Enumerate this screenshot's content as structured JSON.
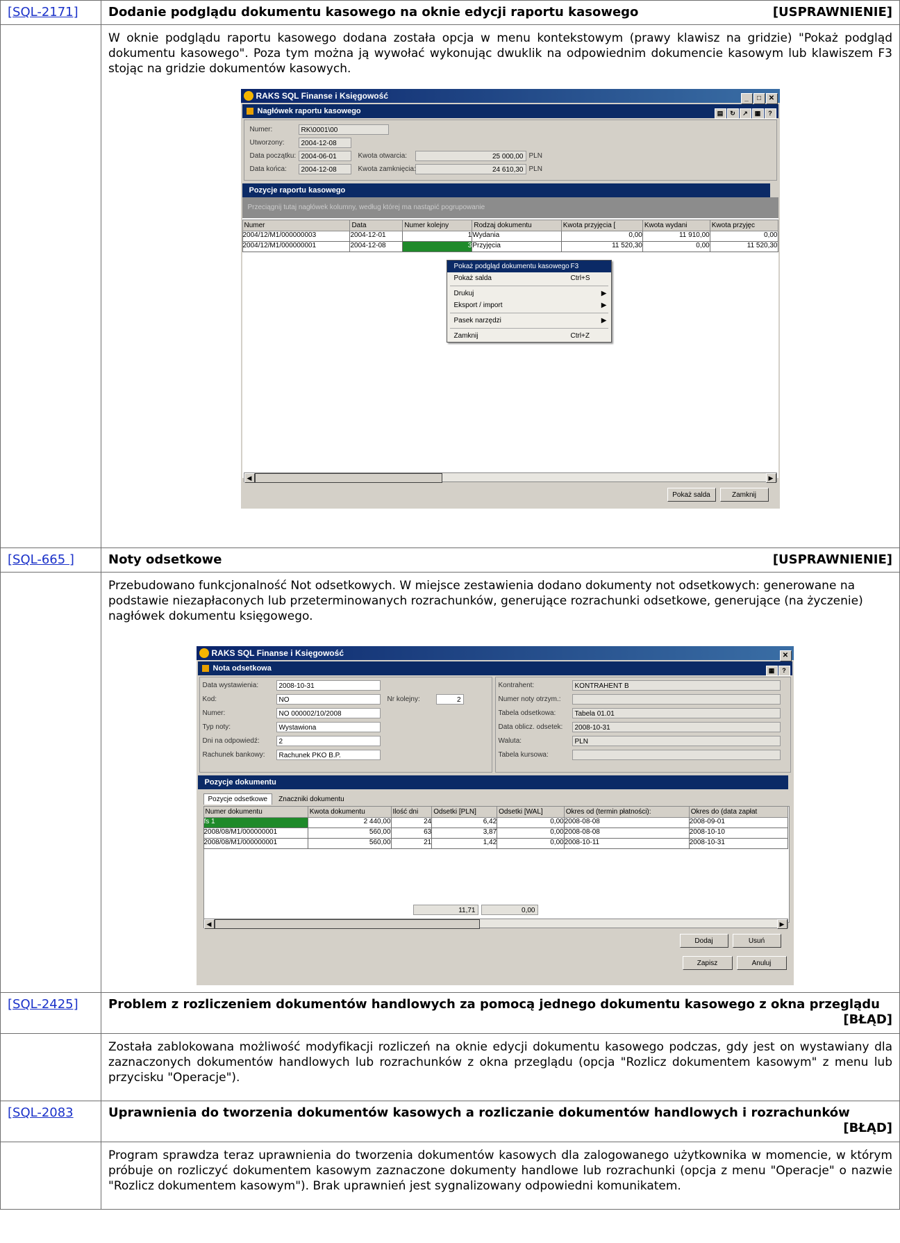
{
  "entries": [
    {
      "id": "[SQL-2171]",
      "title": "Dodanie podglądu dokumentu kasowego na oknie edycji raportu kasowego",
      "tag": "[USPRAWNIENIE]",
      "body": "W oknie podglądu raportu kasowego dodana została opcja w menu kontekstowym (prawy klawisz na gridzie) \"Pokaż podgląd dokumentu kasowego\". Poza tym można ją wywołać wykonując dwuklik na odpowiednim dokumencie kasowym lub klawiszem F3 stojąc na gridzie dokumentów kasowych."
    },
    {
      "id": "[SQL-665 ]",
      "title": "Noty odsetkowe",
      "tag": "[USPRAWNIENIE]",
      "body": "Przebudowano funkcjonalność Not odsetkowych. W miejsce zestawienia dodano dokumenty not odsetkowych: generowane na podstawie niezapłaconych lub przeterminowanych rozrachunków, generujące rozrachunki odsetkowe, generujące (na życzenie) nagłówek dokumentu księgowego."
    },
    {
      "id": "[SQL-2425]",
      "title": "Problem z rozliczeniem dokumentów handlowych za pomocą jednego dokumentu kasowego z okna przeglądu",
      "tag": "[BŁĄD]",
      "body": "Została zablokowana możliwość modyfikacji rozliczeń na oknie edycji dokumentu kasowego podczas, gdy jest on wystawiany dla zaznaczonych dokumentów handlowych lub rozrachunków z okna przeglądu (opcja \"Rozlicz dokumentem kasowym\" z menu lub przycisku \"Operacje\")."
    },
    {
      "id": "[SQL-2083",
      "title": "Uprawnienia do tworzenia dokumentów kasowych a rozliczanie dokumentów handlowych i rozrachunków",
      "tag": "[BŁĄD]",
      "body": "Program sprawdza teraz uprawnienia do tworzenia dokumentów kasowych dla zalogowanego użytkownika w momencie, w którym próbuje on rozliczyć dokumentem kasowym zaznaczone dokumenty handlowe lub rozrachunki (opcja z menu \"Operacje\" o nazwie \"Rozlicz dokumentem kasowym\"). Brak uprawnień jest sygnalizowany odpowiedni komunikatem."
    }
  ],
  "shot1": {
    "app_title": "RAKS SQL Finanse i Księgowość",
    "window_title": "Nagłówek raportu kasowego",
    "fields": {
      "numer_label": "Numer:",
      "numer": "RK\\0001\\00",
      "utworzony_label": "Utworzony:",
      "utworzony": "2004-12-08",
      "data_pocz_label": "Data początku:",
      "data_pocz": "2004-06-01",
      "data_konca_label": "Data końca:",
      "data_konca": "2004-12-08",
      "kwota_otw_label": "Kwota otwarcia:",
      "kwota_otw": "25 000,00",
      "kwota_zamk_label": "Kwota zamknięcia:",
      "kwota_zamk": "24 610,30",
      "currency": "PLN"
    },
    "section_title": "Pozycje raportu kasowego",
    "group_hint": "Przeciągnij tutaj nagłówek kolumny, według której ma nastąpić pogrupowanie",
    "columns": [
      "Numer",
      "Data",
      "Numer kolejny",
      "Rodzaj dokumentu",
      "Kwota przyjęcia [",
      "Kwota wydani",
      "Kwota przyjęc"
    ],
    "rows": [
      [
        "2004/12/M1/000000003",
        "2004-12-01",
        "1",
        "Wydania",
        "0,00",
        "11 910,00",
        "0,00"
      ],
      [
        "2004/12/M1/000000001",
        "2004-12-08",
        "3",
        "Przyjęcia",
        "11 520,30",
        "0,00",
        "11 520,30"
      ]
    ],
    "context_menu": [
      {
        "label": "Pokaż podgląd dokumentu kasowego",
        "shortcut": "F3",
        "selected": true
      },
      {
        "label": "Pokaż salda",
        "shortcut": "Ctrl+S"
      },
      {
        "sep": true
      },
      {
        "label": "Drukuj",
        "submenu": true
      },
      {
        "label": "Eksport / import",
        "submenu": true
      },
      {
        "sep": true
      },
      {
        "label": "Pasek narzędzi",
        "submenu": true
      },
      {
        "sep": true
      },
      {
        "label": "Zamknij",
        "shortcut": "Ctrl+Z"
      }
    ],
    "buttons": {
      "saldo": "Pokaż salda",
      "close": "Zamknij"
    }
  },
  "shot2": {
    "app_title": "RAKS SQL Finanse i Księgowość",
    "window_title": "Nota odsetkowa",
    "left_fields": [
      {
        "label": "Data wystawienia:",
        "value": "2008-10-31"
      },
      {
        "label": "Kod:",
        "value": "NO"
      },
      {
        "label": "Numer:",
        "value": "NO 000002/10/2008"
      },
      {
        "label": "Typ noty:",
        "value": "Wystawiona"
      },
      {
        "label": "Dni na odpowiedź:",
        "value": "2"
      },
      {
        "label": "Rachunek bankowy:",
        "value": "Rachunek PKO B.P."
      }
    ],
    "nr_kolejny_label": "Nr kolejny:",
    "nr_kolejny": "2",
    "right_fields": [
      {
        "label": "Kontrahent:",
        "value": "KONTRAHENT B"
      },
      {
        "label": "Numer noty otrzym.:",
        "value": ""
      },
      {
        "label": "Tabela odsetkowa:",
        "value": "Tabela 01.01"
      },
      {
        "label": "Data oblicz. odsetek:",
        "value": "2008-10-31"
      },
      {
        "label": "Waluta:",
        "value": "PLN"
      },
      {
        "label": "Tabela kursowa:",
        "value": ""
      }
    ],
    "section_title": "Pozycje dokumentu",
    "tabs": [
      "Pozycje odsetkowe",
      "Znaczniki dokumentu"
    ],
    "columns": [
      "Numer dokumentu",
      "Kwota dokumentu",
      "Ilość dni",
      "Odsetki [PLN]",
      "Odsetki [WAL]",
      "Okres od (termin płatności):",
      "Okres do (data zapłat"
    ],
    "rows": [
      [
        "fs 1",
        "2 440,00",
        "24",
        "6,42",
        "0,00",
        "2008-08-08",
        "2008-09-01"
      ],
      [
        "2008/08/M1/000000001",
        "560,00",
        "63",
        "3,87",
        "0,00",
        "2008-08-08",
        "2008-10-10"
      ],
      [
        "2008/08/M1/000000001",
        "560,00",
        "21",
        "1,42",
        "0,00",
        "2008-10-11",
        "2008-10-31"
      ]
    ],
    "totals": {
      "pln": "11,71",
      "wal": "0,00"
    },
    "buttons": {
      "add": "Dodaj",
      "remove": "Usuń",
      "save": "Zapisz",
      "cancel": "Anuluj"
    }
  },
  "colors": {
    "link": "#1a31c9",
    "titlebar": "#0b2a66",
    "selected_row": "#1f8a2a"
  }
}
